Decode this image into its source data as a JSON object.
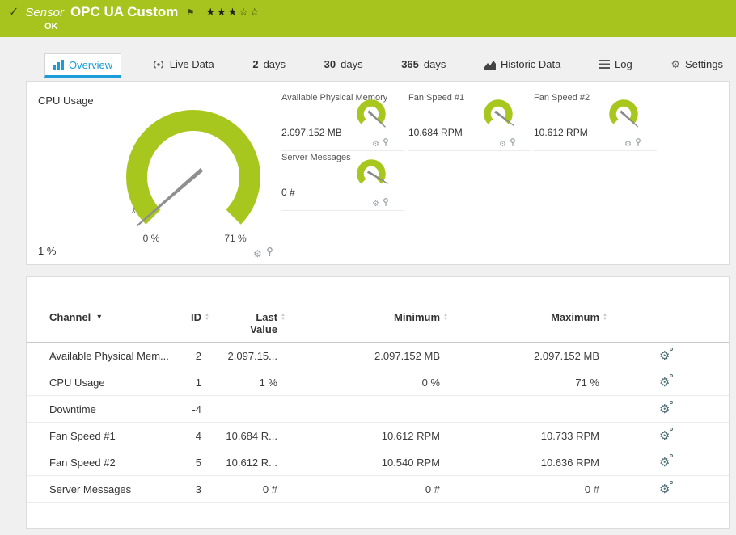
{
  "colors": {
    "header_green": "#a6c31e",
    "gauge_green": "#a8c71e",
    "active_tab_blue": "#1b9dd9"
  },
  "icons": {
    "check": "✓",
    "flag": "⚑",
    "gear": "⚙",
    "caret_down": "▾",
    "sort_up": "▲",
    "sort_down": "▼"
  },
  "header": {
    "kind": "Sensor",
    "title": "OPC UA Custom",
    "status": "OK",
    "stars_filled": "★★★",
    "stars_empty": "☆☆"
  },
  "tabs": [
    {
      "label": "Overview"
    },
    {
      "label": "Live Data"
    },
    {
      "num": "2",
      "label": "days"
    },
    {
      "num": "30",
      "label": "days"
    },
    {
      "num": "365",
      "label": "days"
    },
    {
      "label": "Historic Data"
    },
    {
      "label": "Log"
    },
    {
      "label": "Settings"
    }
  ],
  "gauges": {
    "cpu": {
      "title": "CPU Usage",
      "value": "1 %",
      "min_label": "0 %",
      "max_label": "71 %",
      "needle_deg": -131,
      "avg_marker": "x̄"
    },
    "memory": {
      "title": "Available Physical Memory",
      "value": "2.097.152 MB",
      "needle_deg": 133
    },
    "fan1": {
      "title": "Fan Speed #1",
      "value": "10.684 RPM",
      "needle_deg": 127
    },
    "fan2": {
      "title": "Fan Speed #2",
      "value": "10.612 RPM",
      "needle_deg": 132
    },
    "server": {
      "title": "Server Messages",
      "value": "0 #",
      "needle_deg": 121
    }
  },
  "table": {
    "headers": {
      "channel": "Channel",
      "id": "ID",
      "last": "Last Value",
      "min": "Minimum",
      "max": "Maximum"
    },
    "rows": [
      {
        "channel": "Available Physical Mem...",
        "id": "2",
        "last": "2.097.15...",
        "min": "2.097.152 MB",
        "max": "2.097.152 MB"
      },
      {
        "channel": "CPU Usage",
        "id": "1",
        "last": "1 %",
        "min": "0 %",
        "max": "71 %"
      },
      {
        "channel": "Downtime",
        "id": "-4",
        "last": "",
        "min": "",
        "max": ""
      },
      {
        "channel": "Fan Speed #1",
        "id": "4",
        "last": "10.684 R...",
        "min": "10.612 RPM",
        "max": "10.733 RPM"
      },
      {
        "channel": "Fan Speed #2",
        "id": "5",
        "last": "10.612 R...",
        "min": "10.540 RPM",
        "max": "10.636 RPM"
      },
      {
        "channel": "Server Messages",
        "id": "3",
        "last": "0 #",
        "min": "0 #",
        "max": "0 #"
      }
    ]
  }
}
